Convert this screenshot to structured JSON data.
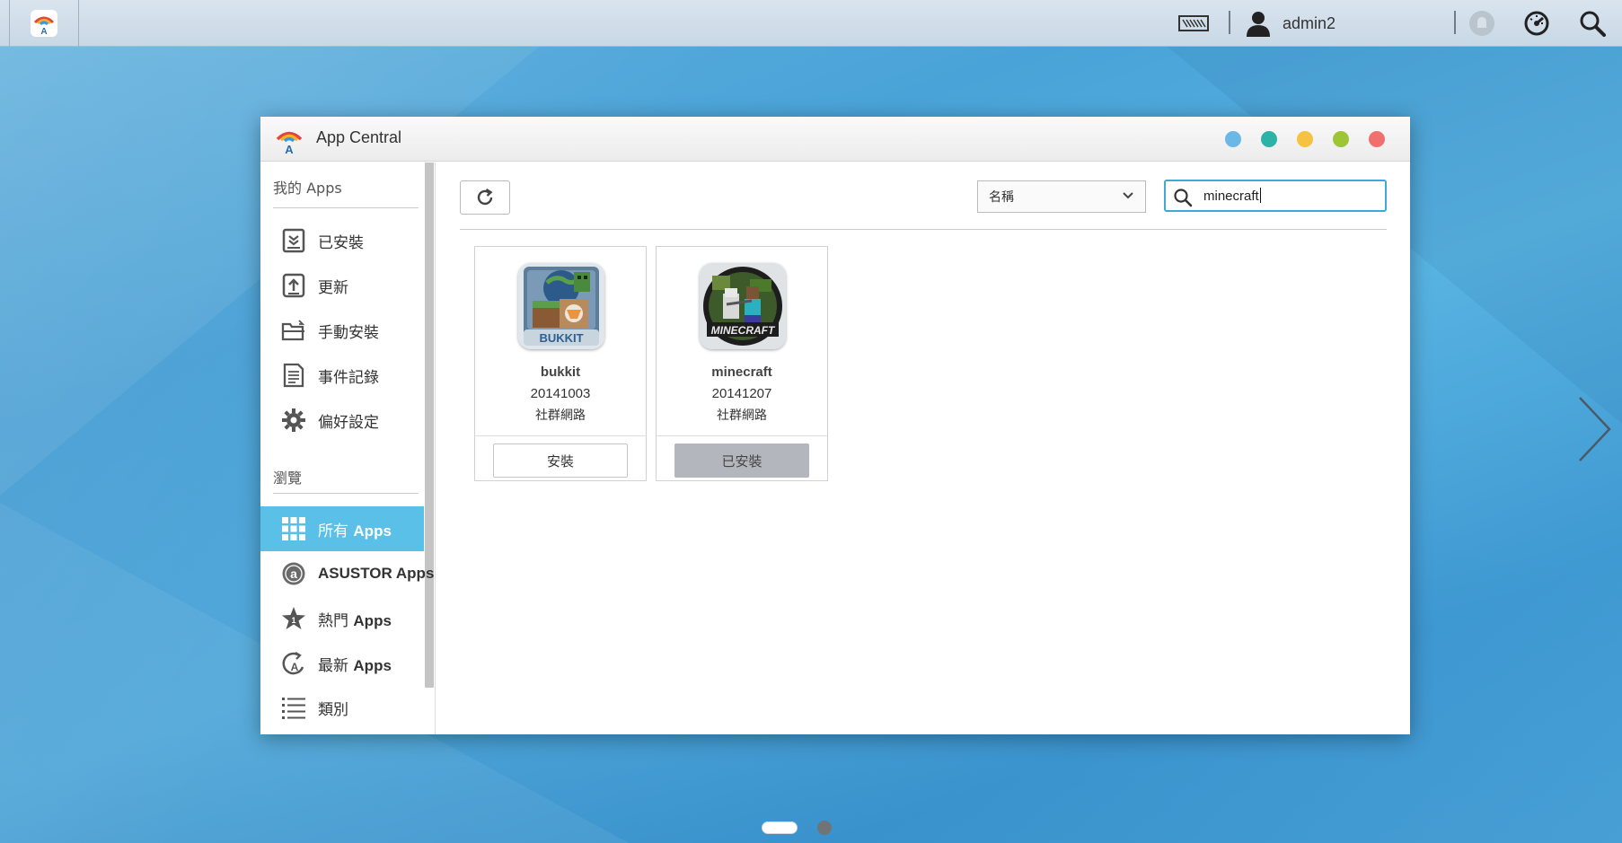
{
  "taskbar": {
    "username": "admin2",
    "icons": [
      "app-central-icon",
      "keyboard-icon",
      "user-icon",
      "notification-icon",
      "dashboard-icon",
      "search-icon"
    ]
  },
  "window": {
    "title": "App Central",
    "control_colors": [
      "#6bb8e6",
      "#2bb3a8",
      "#f5c242",
      "#9cc636",
      "#f07070"
    ]
  },
  "sidebar": {
    "my_apps_heading": "我的 Apps",
    "browse_heading": "瀏覽",
    "my_items": [
      {
        "label": "已安裝",
        "icon": "installed-icon"
      },
      {
        "label": "更新",
        "icon": "update-icon"
      },
      {
        "label": "手動安裝",
        "icon": "folder-icon"
      },
      {
        "label": "事件記錄",
        "icon": "log-icon"
      },
      {
        "label": "偏好設定",
        "icon": "gear-icon"
      }
    ],
    "browse_items": [
      {
        "label_a": "所有 ",
        "label_b": "Apps",
        "icon": "grid-icon",
        "active": true
      },
      {
        "label_a": "",
        "label_b": "ASUSTOR Apps",
        "icon": "asustor-icon",
        "active": false
      },
      {
        "label_a": "熱門 ",
        "label_b": "Apps",
        "icon": "star-icon",
        "active": false
      },
      {
        "label_a": "最新 ",
        "label_b": "Apps",
        "icon": "new-icon",
        "active": false
      },
      {
        "label_a": "類別",
        "label_b": "",
        "icon": "list-icon",
        "active": false
      }
    ]
  },
  "toolbar": {
    "sort_selected": "名稱",
    "search_value": "minecraft"
  },
  "apps": [
    {
      "name": "bukkit",
      "version": "20141003",
      "category": "社群網路",
      "action": "安裝",
      "installed": false
    },
    {
      "name": "minecraft",
      "version": "20141207",
      "category": "社群網路",
      "action": "已安裝",
      "installed": true
    }
  ],
  "colors": {
    "accent": "#3fa8d8",
    "active_nav": "#5bc0e8"
  }
}
